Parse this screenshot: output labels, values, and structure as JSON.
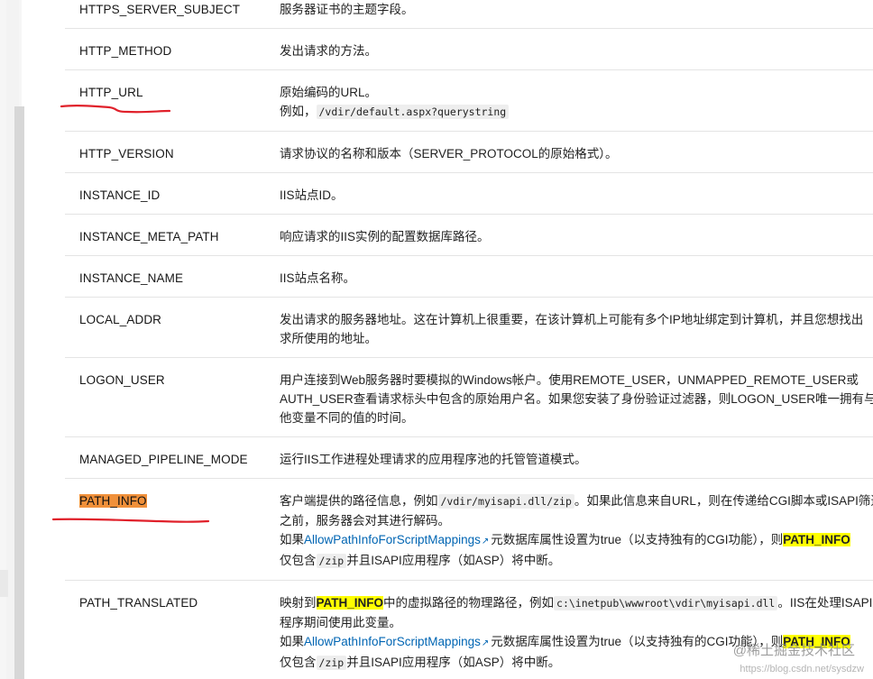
{
  "rows": [
    {
      "name": "HTTPS_SERVER_SUBJECT",
      "desc": [
        "服务器证书的主题字段。"
      ]
    },
    {
      "name": "HTTP_METHOD",
      "desc": [
        "发出请求的方法。"
      ]
    },
    {
      "name": "HTTP_URL",
      "desc": [
        "原始编码的URL。",
        "例如，",
        "/vdir/default.aspx?querystring"
      ]
    },
    {
      "name": "HTTP_VERSION",
      "desc": [
        "请求协议的名称和版本（SERVER_PROTOCOL的原始格式）。"
      ]
    },
    {
      "name": "INSTANCE_ID",
      "desc": [
        "IIS站点ID。"
      ]
    },
    {
      "name": "INSTANCE_META_PATH",
      "desc": [
        "响应请求的IIS实例的配置数据库路径。"
      ]
    },
    {
      "name": "INSTANCE_NAME",
      "desc": [
        "IIS站点名称。"
      ]
    },
    {
      "name": "LOCAL_ADDR",
      "desc": [
        "发出请求的服务器地址。这在计算机上很重要，在该计算机上可能有多个IP地址绑定到计算机，并且您想找出",
        "求所使用的地址。"
      ]
    },
    {
      "name": "LOGON_USER",
      "desc": [
        "用户连接到Web服务器时要模拟的Windows帐户。使用REMOTE_USER，UNMAPPED_REMOTE_USER或",
        "AUTH_USER查看请求标头中包含的原始用户名。如果您安装了身份验证过滤器，则LOGON_USER唯一拥有与",
        "他变量不同的值的时间。"
      ]
    },
    {
      "name": "MANAGED_PIPELINE_MODE",
      "desc": [
        "运行IIS工作进程处理请求的应用程序池的托管管道模式。"
      ]
    },
    {
      "name": "PATH_INFO",
      "desc": {
        "l1_a": "客户端提供的路径信息，例如",
        "l1_code": "/vdir/myisapi.dll/zip",
        "l1_b": "。如果此信息来自URL，则在传递给CGI脚本或ISAPI筛选",
        "l2": "之前，服务器会对其进行解码。",
        "l3_a": "如果",
        "l3_link": "AllowPathInfoForScriptMappings",
        "l3_b": "元数据库属性设置为true（以支持独有的CGI功能），则",
        "l3_hl": "PATH_INFO",
        "l4_a": "仅包含",
        "l4_code": "/zip",
        "l4_b": "并且ISAPI应用程序（如ASP）将中断。"
      }
    },
    {
      "name": "PATH_TRANSLATED",
      "desc": {
        "l1_a": "映射到",
        "l1_hl": "PATH_INFO",
        "l1_b": "中的虚拟路径的物理路径，例如",
        "l1_code": "c:\\inetpub\\wwwroot\\vdir\\myisapi.dll",
        "l1_c": "。IIS在处理ISAPI应",
        "l2": "程序期间使用此变量。",
        "l3_a": "如果",
        "l3_link": "AllowPathInfoForScriptMappings",
        "l3_b": "元数据库属性设置为true（以支持独有的CGI功能），则",
        "l3_hl": "PATH_INFO",
        "l4_a": "仅包含",
        "l4_code": "/zip",
        "l4_b": "并且ISAPI应用程序（如ASP）将中断。"
      }
    }
  ],
  "icons": {
    "external_link": "external-link-icon"
  },
  "colors": {
    "highlight": "#ffff00",
    "name_highlight": "#f0903a",
    "annotation": "#e0202a",
    "link": "#0065b3"
  },
  "watermark": {
    "main": "@稀土掘金技术社区",
    "sub": "https://blog.csdn.net/sysdzw"
  }
}
